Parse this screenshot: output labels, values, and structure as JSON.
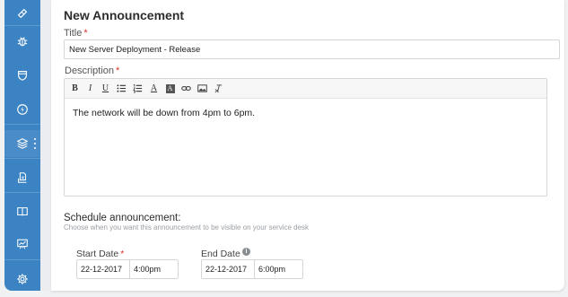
{
  "sidebar": {
    "items": [
      {
        "icon": "ticket-icon"
      },
      {
        "icon": "bug-icon"
      },
      {
        "icon": "shield-icon"
      },
      {
        "icon": "lightning-icon"
      },
      {
        "icon": "layers-icon"
      },
      {
        "icon": "document-stack-icon"
      },
      {
        "icon": "book-icon"
      },
      {
        "icon": "presentation-chart-icon"
      },
      {
        "icon": "gear-icon"
      }
    ],
    "background_color": "#3b83c3"
  },
  "form": {
    "heading": "New Announcement",
    "title_label": "Title",
    "title_value": "New Server Deployment - Release",
    "required_marker": "*",
    "description_label": "Description",
    "toolbar": {
      "bold": "B",
      "italic": "I",
      "underline": "U",
      "text_color": "A",
      "highlight": "A"
    },
    "description_text": "The network will be down from 4pm to 6pm.",
    "schedule_heading": "Schedule announcement:",
    "schedule_hint": "Choose when you want this announcement to be visible on your service desk",
    "start_date_label": "Start Date",
    "start_date": "22-12-2017",
    "start_time": "4:00pm",
    "end_date_label": "End Date",
    "end_date": "22-12-2017",
    "end_time": "6:00pm",
    "info_glyph": "i"
  },
  "colors": {
    "required": "#d9342b",
    "accent": "#3b83c3"
  }
}
